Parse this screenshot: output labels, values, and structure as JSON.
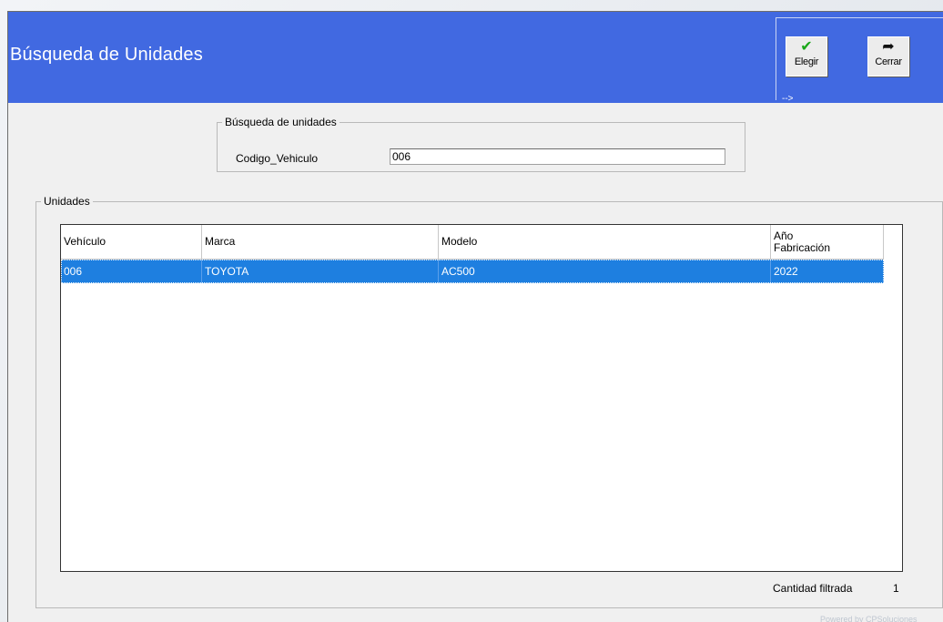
{
  "window": {
    "title": "Búsqueda de Unidades"
  },
  "toolbar": {
    "elegir_label": "Elegir",
    "cerrar_label": "Cerrar",
    "panel_arrow": "-->"
  },
  "search": {
    "group_label": "Búsqueda de unidades",
    "field_label": "Codigo_Vehiculo",
    "field_value": "006"
  },
  "unidades": {
    "group_label": "Unidades",
    "columns": [
      "Vehículo",
      "Marca",
      "Modelo",
      "Año\nFabricación"
    ],
    "rows": [
      {
        "vehiculo": "006",
        "marca": "TOYOTA",
        "modelo": "AC500",
        "anio": "2022"
      }
    ],
    "selection_color": "#1e7fe0"
  },
  "status": {
    "count_label": "Cantidad filtrada",
    "count_value": "1"
  },
  "footer": {
    "text": "Powered by CPSoluciones"
  },
  "colors": {
    "header": "#4169e1",
    "check": "#1aa81a"
  },
  "icons": {
    "elegir": "check-icon",
    "cerrar": "share-arrow-icon"
  }
}
